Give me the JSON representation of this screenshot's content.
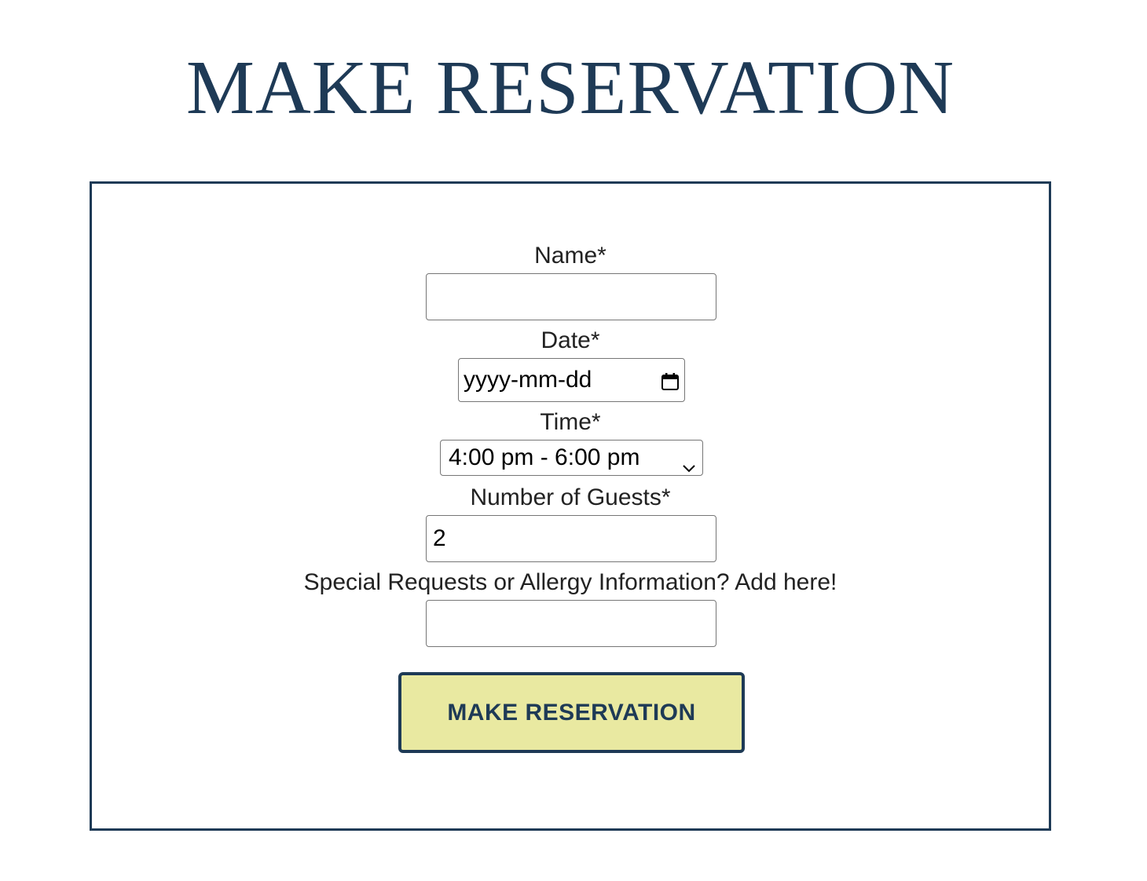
{
  "page": {
    "title": "MAKE RESERVATION"
  },
  "form": {
    "name_label": "Name*",
    "name_value": "",
    "date_label": "Date*",
    "date_value": "yyyy-mm-dd",
    "time_label": "Time*",
    "time_value": "4:00 pm - 6:00 pm",
    "guests_label": "Number of Guests*",
    "guests_value": "2",
    "requests_label": "Special Requests or Allergy Information? Add here!",
    "requests_value": "",
    "submit_label": "MAKE RESERVATION"
  },
  "colors": {
    "brand_navy": "#1e3a56",
    "button_fill": "#e9e9a1",
    "field_border": "#767676"
  },
  "icons": {
    "date_picker": "calendar-icon",
    "time_select": "chevron-down-icon"
  }
}
